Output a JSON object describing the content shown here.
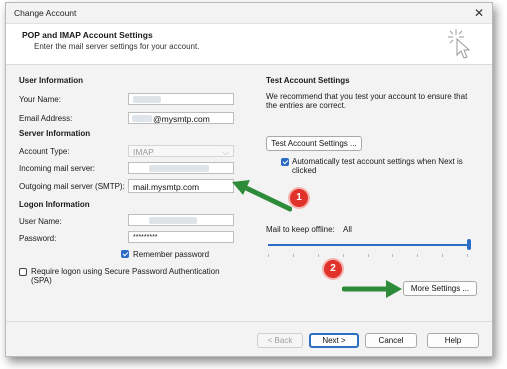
{
  "window": {
    "title": "Change Account",
    "close_glyph": "✕"
  },
  "header": {
    "title": "POP and IMAP Account Settings",
    "subtitle": "Enter the mail server settings for your account."
  },
  "user_info": {
    "heading": "User Information",
    "your_name_label": "Your Name:",
    "email_label": "Email Address:",
    "email_value": "@mysmtp.com"
  },
  "server_info": {
    "heading": "Server Information",
    "account_type_label": "Account Type:",
    "account_type_value": "IMAP",
    "incoming_label": "Incoming mail server:",
    "outgoing_label": "Outgoing mail server (SMTP):",
    "outgoing_value": "mail.mysmtp.com"
  },
  "logon_info": {
    "heading": "Logon Information",
    "user_name_label": "User Name:",
    "password_label": "Password:",
    "password_value": "*********",
    "remember_label": "Remember password",
    "spa_label": "Require logon using Secure Password Authentication (SPA)"
  },
  "test": {
    "heading": "Test Account Settings",
    "description": "We recommend that you test your account to ensure that the entries are correct.",
    "test_button": "Test Account Settings ...",
    "auto_label": "Automatically test account settings when Next is clicked"
  },
  "offline": {
    "label": "Mail to keep offline:",
    "value": "All",
    "slider_level": 1.0
  },
  "more_settings_button": "More Settings ...",
  "footer": {
    "back": "< Back",
    "next": "Next >",
    "cancel": "Cancel",
    "help": "Help"
  },
  "annotations": {
    "badge1": "1",
    "badge2": "2",
    "badge_color": "#e0322a",
    "arrow_color": "#2e8b3a"
  },
  "colors": {
    "accent": "#2b6cc4"
  }
}
